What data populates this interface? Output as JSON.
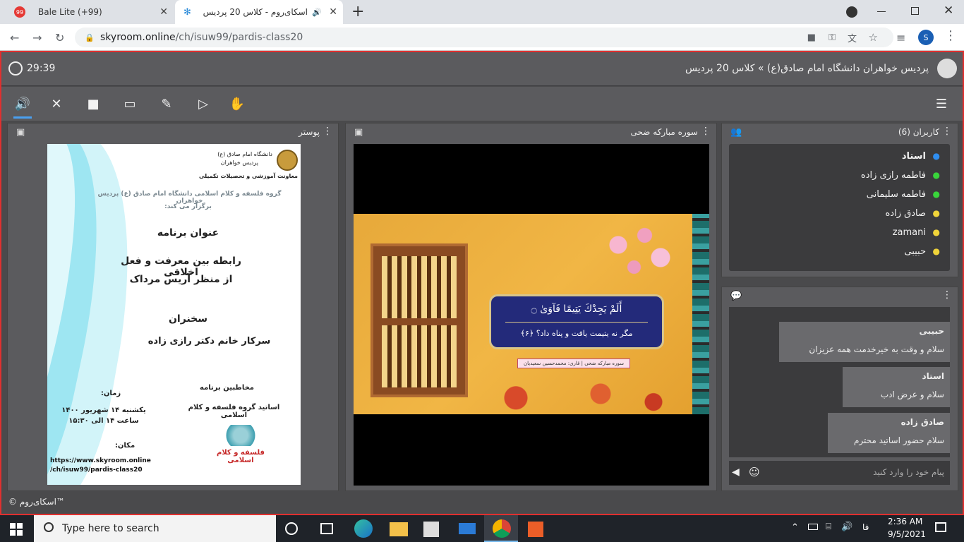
{
  "browser": {
    "tabs": [
      {
        "title": "Bale Lite (+99)",
        "badge": "99"
      },
      {
        "title": "اسکای‌روم - کلاس 20 پردیس"
      }
    ],
    "new_tab_label": "+",
    "url_host": "skyroom.online",
    "url_path": "/ch/isuw99/pardis-class20",
    "profile_initial": "S"
  },
  "app": {
    "timer": "29:39",
    "breadcrumb": "پردیس خواهران دانشگاه امام صادق(ع) » کلاس 20 پردیس",
    "footer": "© اسکای‌روم™"
  },
  "panels": {
    "poster_title": "پوستر",
    "video_title": "سوره مبارکه ضحی",
    "users_title": "کاربران (6)"
  },
  "poster": {
    "uni_line1": "دانشگاه امام صادق (ع)",
    "uni_line2": "پردیس خواهران",
    "dept": "معاونت آموزشی و تحصیلات تکمیلی",
    "intro1": "گروه فلسفه و کلام اسلامی دانشگاه امام صادق (ع) پردیس خواهران",
    "intro2": "برگزار می کند:",
    "heading": "عنوان برنامه",
    "topic1": "رابطه بین معرفت و فعل اخلاقی",
    "topic2": "از منظر آریس مرداک",
    "speaker_heading": "سخنران",
    "speaker": "سرکار خانم دکتر رازی زاده",
    "audience_heading": "مخاطبین برنامه",
    "audience": "اساتید گروه فلسفه و کلام اسلامی",
    "time_heading": "زمان:",
    "time1": "یکشنبه ۱۴ شهریور ۱۴۰۰",
    "time2": "ساعت ۱۴ الی ۱۵:۳۰",
    "place_heading": "مکان:",
    "place1": "https://www.skyroom.online",
    "place2": "/ch/isuw99/pardis-class20",
    "logo_text": "فلسفه و کلام اسلامی"
  },
  "video": {
    "verse_arabic": "أَلَمْ يَجِدْكَ يَتِيمًا فَآوَىٰ ۝",
    "verse_persian": "مگر نه یتیمت یافت و پناه داد؟ ﴿۶﴾",
    "credit": "سوره مبارکه ضحی | قاری: محمدحسین سعیدیان"
  },
  "users": [
    {
      "name": "استاد",
      "color": "#2f8ef0",
      "bold": true
    },
    {
      "name": "فاطمه رازی زاده",
      "color": "#39d43b"
    },
    {
      "name": "فاطمه سلیمانی",
      "color": "#39d43b"
    },
    {
      "name": "صادق زاده",
      "color": "#f0d43a"
    },
    {
      "name": "zamani",
      "color": "#f0d43a"
    },
    {
      "name": "حبیبی",
      "color": "#f0d43a"
    }
  ],
  "chat": {
    "messages": [
      {
        "sender": "حبیبی",
        "text": "سلام و وقت به خیرخدمت همه عزیزان"
      },
      {
        "sender": "استاد",
        "text": "سلام و عرض ادب"
      },
      {
        "sender": "صادق زاده",
        "text": "سلام حضور اساتید محترم"
      }
    ],
    "placeholder": "پیام خود را وارد کنید"
  },
  "taskbar": {
    "search_placeholder": "Type here to search",
    "lang": "فا",
    "time": "2:36 AM",
    "date": "9/5/2021"
  }
}
